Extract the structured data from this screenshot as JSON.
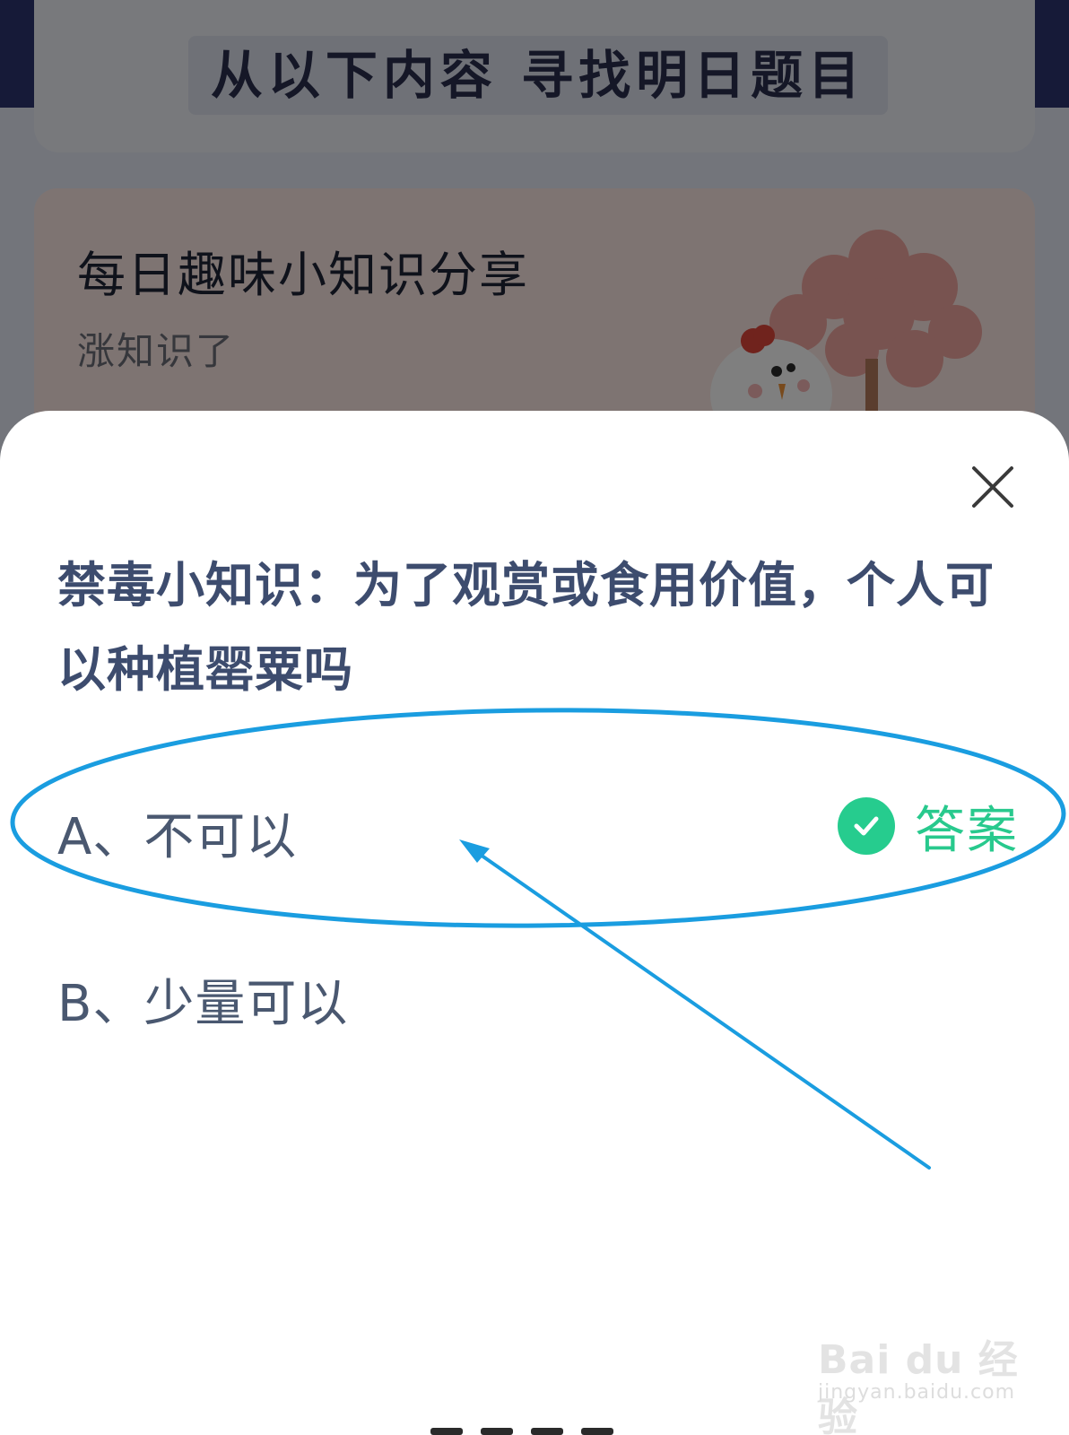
{
  "background": {
    "banner_title": "从以下内容 寻找明日题目",
    "tip_card": {
      "title": "每日趣味小知识分享",
      "subtitle": "涨知识了"
    }
  },
  "sheet": {
    "close_icon": "close-icon",
    "question": "禁毒小知识：为了观赏或食用价值，个人可以种植罂粟吗",
    "options": [
      {
        "label": "A、不可以",
        "is_answer": true
      },
      {
        "label": "B、少量可以",
        "is_answer": false
      }
    ],
    "answer_badge": {
      "icon": "check-circle-icon",
      "label": "答案"
    }
  },
  "watermark": {
    "logo": "Bai du 经验",
    "url": "jingyan.baidu.com"
  },
  "colors": {
    "question_text": "#3d4c6e",
    "answer_green": "#26cc8e",
    "annotation_blue": "#1a9de0",
    "overlay": "rgba(0,0,0,0.5)"
  }
}
